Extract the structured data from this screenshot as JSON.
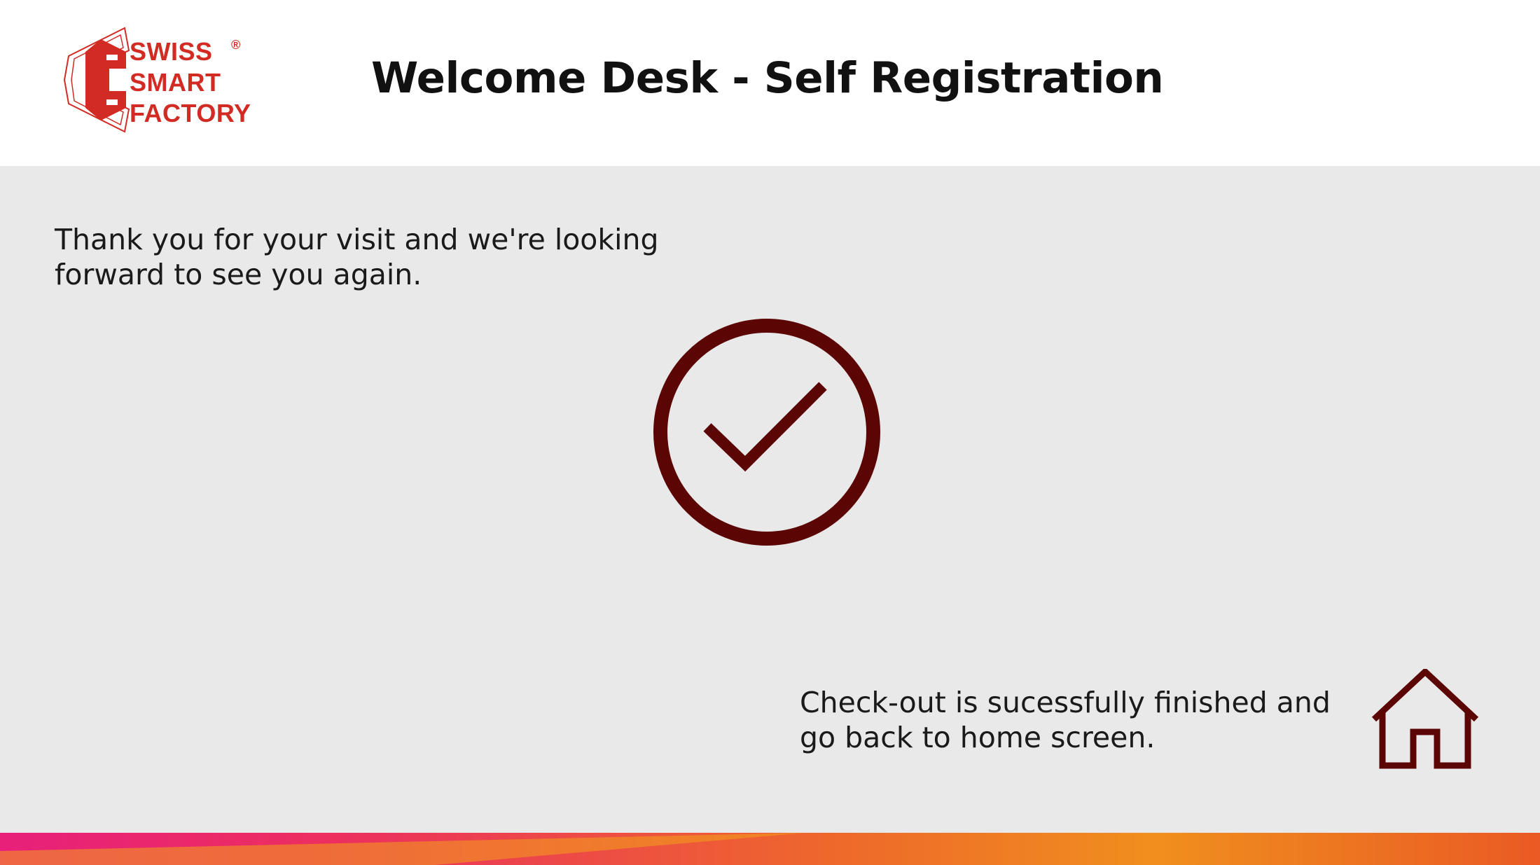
{
  "header": {
    "logo_lines": [
      "SWISS",
      "SMART",
      "FACTORY"
    ],
    "logo_reg": "®",
    "title": "Welcome Desk - Self Registration"
  },
  "main": {
    "thanks_lines": [
      "Thank you for your visit and we're looking",
      "forward to see you again."
    ],
    "status_icon": "checkmark-circle-icon",
    "checkout_lines": [
      "Check-out is sucessfully finished and",
      "go back to home screen."
    ],
    "home_icon": "home-icon"
  },
  "colors": {
    "brand_red": "#d22b23",
    "icon_maroon": "#5c0505",
    "background": "#e9e9e9",
    "header_bg": "#ffffff"
  }
}
